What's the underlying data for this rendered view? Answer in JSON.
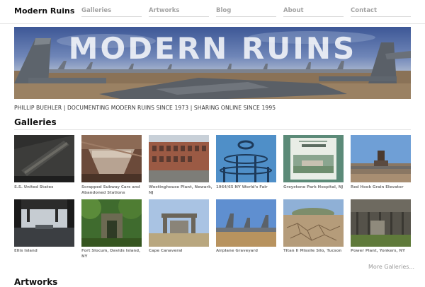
{
  "site": {
    "brand": "Modern Ruins",
    "nav": [
      "Galleries",
      "Artworks",
      "Blog",
      "About",
      "Contact"
    ]
  },
  "hero": {
    "title": "MODERN RUINS"
  },
  "tagline": "PHILLIP BUEHLER | DOCUMENTING MODERN RUINS SINCE 1973 | SHARING ONLINE SINCE 1995",
  "galleries": {
    "heading": "Galleries",
    "items": [
      {
        "caption": "S.S. United States",
        "icon": "ship-hull-image"
      },
      {
        "caption": "Scrapped Subway Cars and Abandoned Stations",
        "icon": "subway-car-image"
      },
      {
        "caption": "Westinghouse Plant, Newark, NJ",
        "icon": "factory-building-image"
      },
      {
        "caption": "1964/65 NY World's Fair",
        "icon": "observation-towers-image"
      },
      {
        "caption": "Greystone Park Hospital, NJ",
        "icon": "book-cover-image"
      },
      {
        "caption": "Red Hook Grain Elevator",
        "icon": "grain-elevator-image"
      },
      {
        "caption": "Ellis Island",
        "icon": "ferry-slip-image"
      },
      {
        "caption": "Fort Slocum, Davids Island, NY",
        "icon": "overgrown-ruin-image"
      },
      {
        "caption": "Cape Canaveral",
        "icon": "launch-gantry-image"
      },
      {
        "caption": "Airplane Graveyard",
        "icon": "bomber-tails-image"
      },
      {
        "caption": "Titan II Missile Silo, Tucson",
        "icon": "cracked-earth-image"
      },
      {
        "caption": "Power Plant, Yonkers, NY",
        "icon": "turbine-hall-image"
      }
    ],
    "more_link": "More Galleries..."
  },
  "artworks": {
    "heading": "Artworks"
  },
  "colors": {
    "nav_text": "#a3a3a3",
    "caption_text": "#7a7a7a",
    "sky": "#4f6aa3",
    "ground": "#8a7257"
  }
}
